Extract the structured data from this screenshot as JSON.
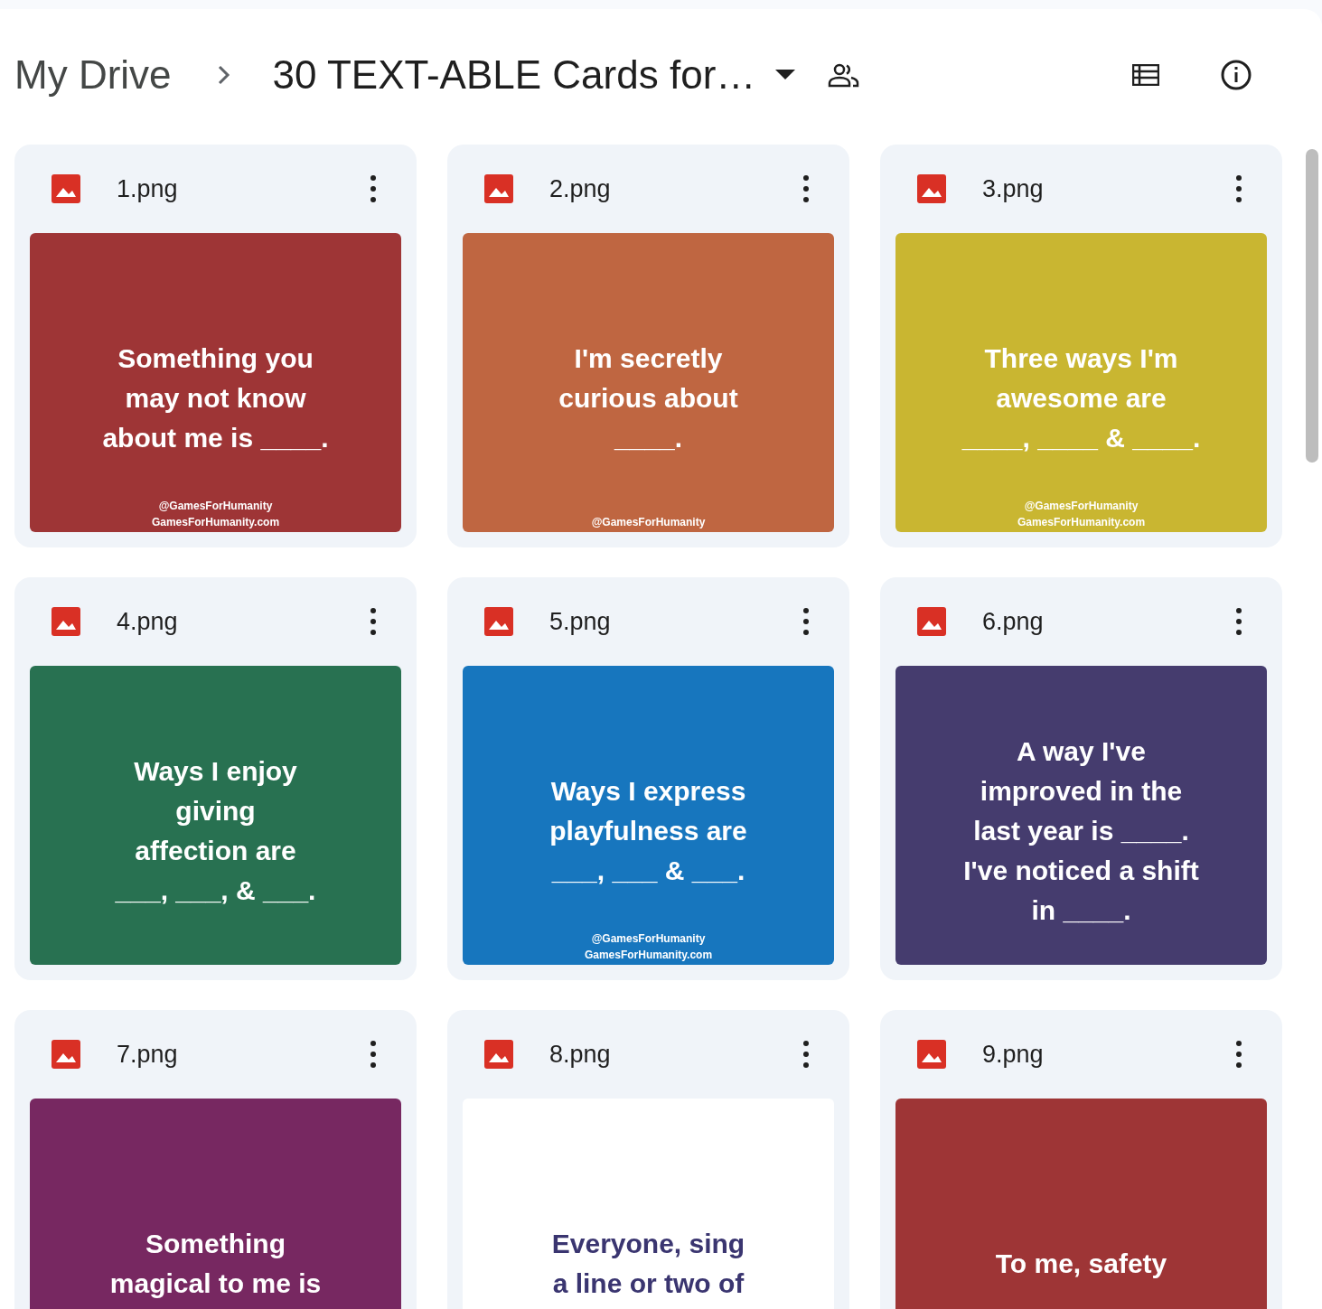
{
  "breadcrumb": {
    "root": "My Drive",
    "folder": "30 TEXT-ABLE Cards for…"
  },
  "files": [
    {
      "name": "1.png",
      "thumbnail": {
        "color": "#9e3536",
        "kind": "dark",
        "text": "Something you\nmay not know\nabout  me is ____.",
        "credit": [
          "@GamesForHumanity",
          "GamesForHumanity.com"
        ]
      }
    },
    {
      "name": "2.png",
      "thumbnail": {
        "color": "#bf6641",
        "kind": "dark",
        "text": "I'm secretly\ncurious about\n____.",
        "credit": [
          "@GamesForHumanity"
        ]
      }
    },
    {
      "name": "3.png",
      "thumbnail": {
        "color": "#c9b631",
        "kind": "dark",
        "text": "Three ways I'm\nawesome are\n____, ____ & ____.",
        "credit": [
          "@GamesForHumanity",
          "GamesForHumanity.com"
        ]
      }
    },
    {
      "name": "4.png",
      "thumbnail": {
        "color": "#287151",
        "kind": "dark",
        "text": "Ways I enjoy\ngiving\naffection are\n___, ___, & ___."
      }
    },
    {
      "name": "5.png",
      "thumbnail": {
        "color": "#1776be",
        "kind": "dark",
        "text": "Ways I express\nplayfulness are\n___, ___ & ___.",
        "credit": [
          "@GamesForHumanity",
          "GamesForHumanity.com"
        ]
      }
    },
    {
      "name": "6.png",
      "thumbnail": {
        "color": "#453c6e",
        "kind": "dark",
        "text": "A way I've\nimproved in the\nlast year is ____.\nI've noticed a shift\nin ____."
      }
    },
    {
      "name": "7.png",
      "thumbnail": {
        "color": "#772861",
        "kind": "dark",
        "text": "Something\nmagical to me is"
      }
    },
    {
      "name": "8.png",
      "thumbnail": {
        "color": "#ffffff",
        "kind": "light",
        "text": "Everyone, sing\na line or two of"
      }
    },
    {
      "name": "9.png",
      "thumbnail": {
        "color": "#9e3536",
        "kind": "dark",
        "text": "To me, safety"
      }
    }
  ]
}
